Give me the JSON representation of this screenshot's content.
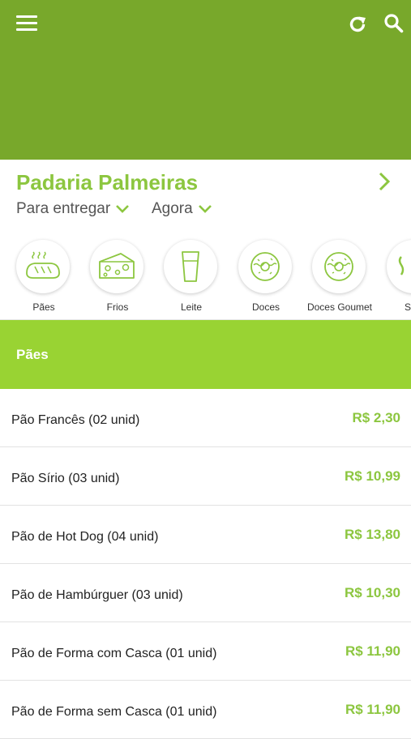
{
  "header": {
    "background_color": "#78a82b",
    "icons": [
      "menu-icon",
      "refresh-icon",
      "search-icon"
    ]
  },
  "store": {
    "name": "Padaria Palmeiras",
    "delivery_mode": "Para entregar",
    "delivery_time": "Agora",
    "accent_color": "#8cc63f"
  },
  "categories": [
    {
      "label": "Pães",
      "icon": "bread-icon"
    },
    {
      "label": "Frios",
      "icon": "cheese-icon"
    },
    {
      "label": "Leite",
      "icon": "milk-glass-icon"
    },
    {
      "label": "Doces",
      "icon": "donut-icon"
    },
    {
      "label": "Doces Goumet",
      "icon": "donut-icon"
    },
    {
      "label": "Salg",
      "icon": "savory-icon"
    }
  ],
  "section": {
    "title": "Pães",
    "background_color": "#99d333"
  },
  "products": [
    {
      "name": "Pão Francês (02 unid)",
      "price": "R$ 2,30"
    },
    {
      "name": "Pão Sírio (03 unid)",
      "price": "R$ 10,99"
    },
    {
      "name": "Pão de Hot Dog (04 unid)",
      "price": "R$ 13,80"
    },
    {
      "name": "Pão de Hambúrguer (03 unid)",
      "price": "R$ 10,30"
    },
    {
      "name": "Pão de Forma com Casca (01 unid)",
      "price": "R$ 11,90"
    },
    {
      "name": "Pão de Forma sem Casca (01 unid)",
      "price": "R$ 11,90"
    }
  ]
}
